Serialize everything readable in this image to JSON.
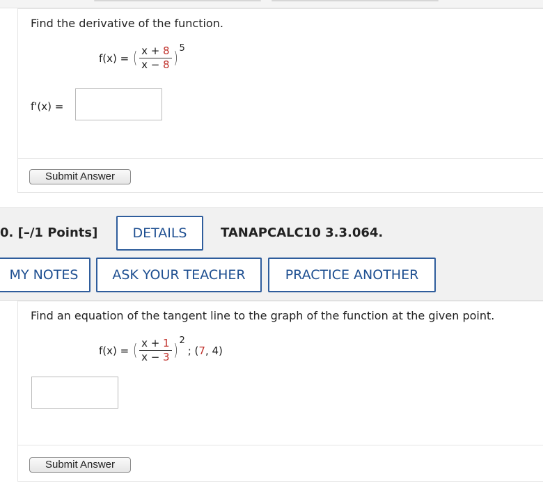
{
  "question_1": {
    "prompt": "Find the derivative of the function.",
    "equation": {
      "lhs": "f(x) =",
      "numerator_var": "x + ",
      "numerator_const": "8",
      "denominator_var": "x − ",
      "denominator_const": "8",
      "exponent": "5"
    },
    "answer_label": "f'(x) =",
    "answer_value": "",
    "submit_label": "Submit Answer"
  },
  "question_header": {
    "number_points": "0.  [–/1 Points]",
    "details_label": "DETAILS",
    "code": "TANAPCALC10 3.3.064.",
    "my_notes_label": "MY NOTES",
    "ask_teacher_label": "ASK YOUR TEACHER",
    "practice_label": "PRACTICE ANOTHER"
  },
  "question_2": {
    "prompt": "Find an equation of the tangent line to the graph of the function at the given point.",
    "equation": {
      "lhs": "f(x) =",
      "numerator_var": "x + ",
      "numerator_const": "1",
      "denominator_var": "x − ",
      "denominator_const": "3",
      "exponent": "2",
      "point_prefix": "; (",
      "point_x": "7",
      "point_suffix": ", 4)"
    },
    "answer_value": "",
    "submit_label": "Submit Answer"
  },
  "colors": {
    "accent_blue": "#1e4f91",
    "constant_red": "#c0312b"
  }
}
